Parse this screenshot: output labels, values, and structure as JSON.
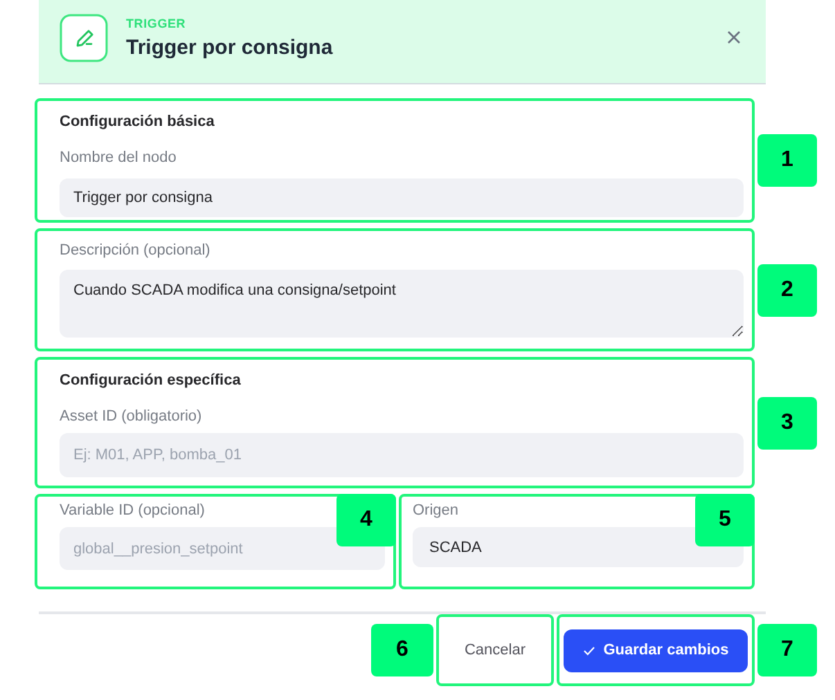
{
  "header": {
    "kicker": "TRIGGER",
    "title": "Trigger por consigna"
  },
  "basic": {
    "heading": "Configuración básica",
    "label": "Nombre del nodo",
    "value": "Trigger por consigna",
    "marker": "1"
  },
  "description": {
    "label": "Descripción (opcional)",
    "value": "Cuando SCADA modifica una consigna/setpoint",
    "marker": "2"
  },
  "specific": {
    "heading": "Configuración específica",
    "label": "Asset ID (obligatorio)",
    "placeholder": "Ej: M01, APP, bomba_01",
    "marker": "3"
  },
  "variable": {
    "label": "Variable ID (opcional)",
    "placeholder": "global__presion_setpoint",
    "marker": "4"
  },
  "origin": {
    "label": "Origen",
    "value": "SCADA",
    "marker": "5"
  },
  "buttons": [
    {
      "label": "Cancelar",
      "kind": "secondary",
      "marker": "6"
    },
    {
      "label": "Guardar cambios",
      "kind": "primary",
      "marker": "7"
    }
  ]
}
